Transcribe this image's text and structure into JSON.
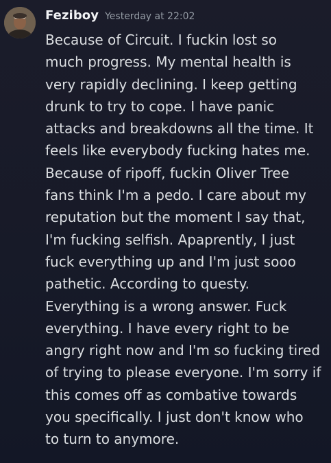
{
  "message": {
    "username": "Feziboy",
    "timestamp": "Yesterday at 22:02",
    "avatar_icon": "user-avatar",
    "lines": [
      "Because of Circuit. I fuckin lost so",
      "much progress. My mental health is",
      "very rapidly declining. I keep getting",
      "drunk to try to cope. I have panic",
      "attacks and breakdowns all the time. It",
      "feels like everybody fucking hates me.",
      "Because of ripoff, fuckin Oliver Tree",
      "fans think I'm a pedo. I care about my",
      "reputation but the moment I say that,",
      "I'm fucking selfish. Apaprently, I just",
      "fuck everything up and I'm just sooo",
      "pathetic. According to questy.",
      "Everything is a wrong answer. Fuck",
      "everything. I have every right to be",
      "angry right now and I'm so fucking tired",
      "of trying to please everyone. I'm sorry if",
      "this comes off as combative towards",
      "you specifically. I just don't know who",
      "to turn to anymore."
    ]
  },
  "colors": {
    "background": "#181a28",
    "username": "#f2f3f5",
    "timestamp": "#949ba4",
    "text": "#dbdee1"
  }
}
